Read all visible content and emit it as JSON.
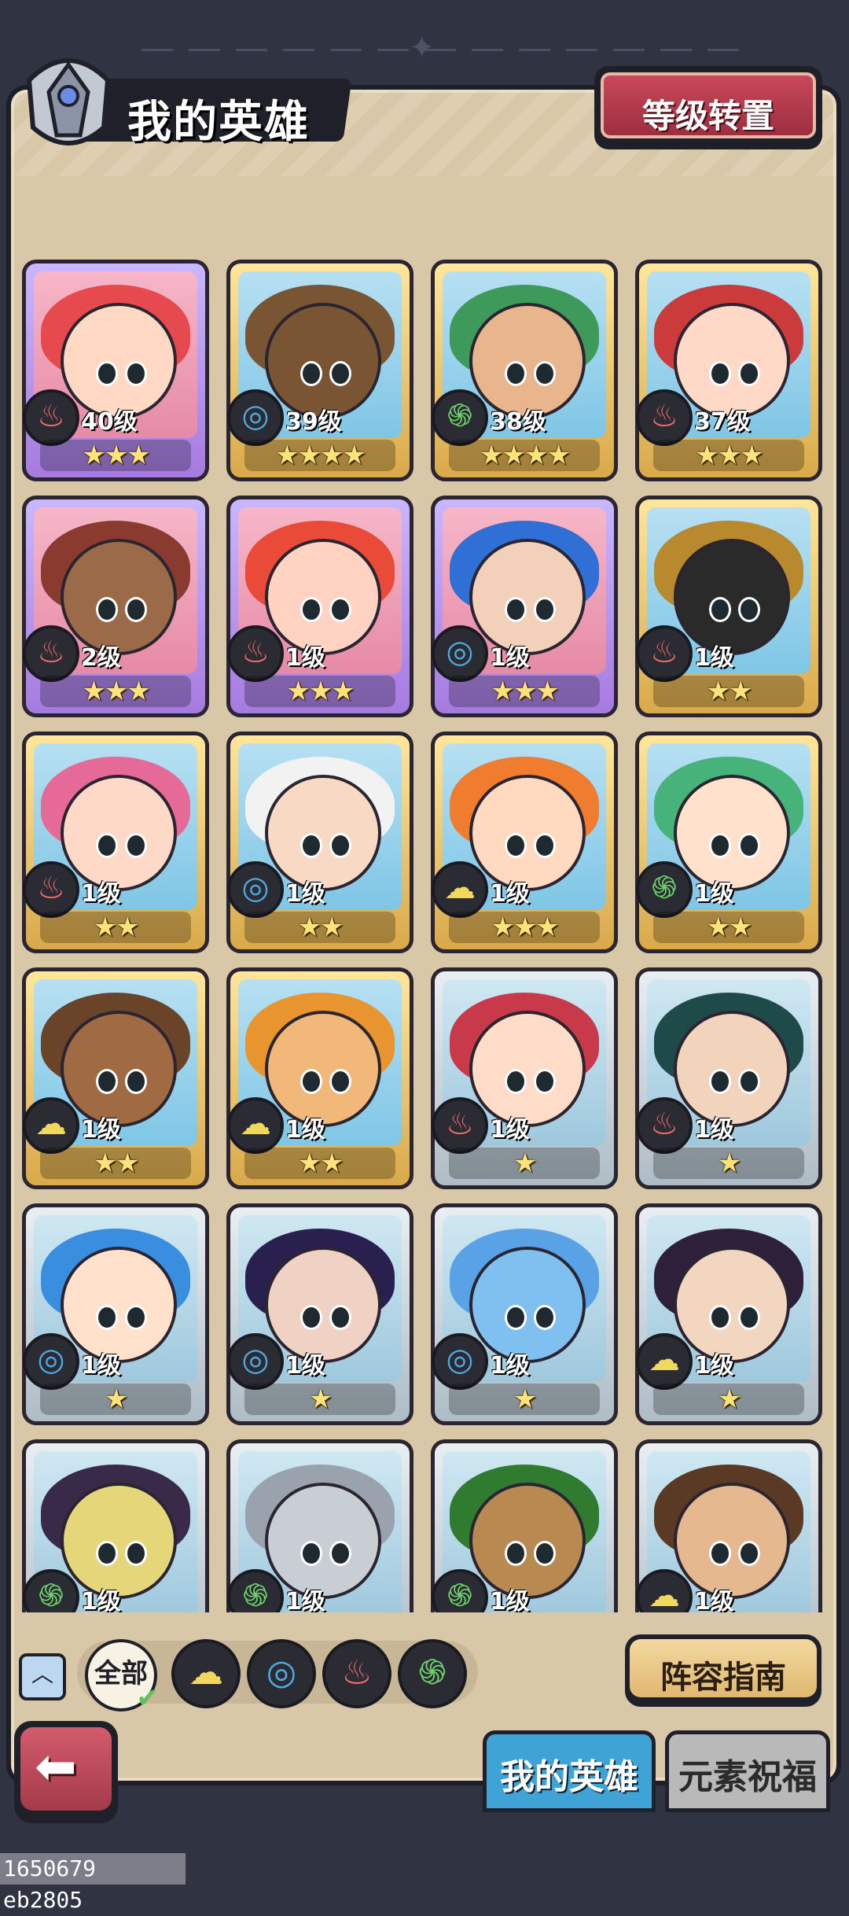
{
  "header": {
    "title": "我的英雄",
    "level_transfer_label": "等级转置"
  },
  "heroes": [
    {
      "level": "40级",
      "stars": "★★★",
      "element": "fire",
      "rarity": "purple",
      "hair": "#e64a4f",
      "skin": "#ffd9c4"
    },
    {
      "level": "39级",
      "stars": "★★★★",
      "element": "water",
      "rarity": "gold",
      "hair": "#7a5534",
      "skin": "#7a5534"
    },
    {
      "level": "38级",
      "stars": "★★★★",
      "element": "wood",
      "rarity": "gold",
      "hair": "#3d9a5b",
      "skin": "#e9b58d"
    },
    {
      "level": "37级",
      "stars": "★★★",
      "element": "fire",
      "rarity": "gold",
      "hair": "#cc3b3b",
      "skin": "#ffd9c8"
    },
    {
      "level": "2级",
      "stars": "★★★",
      "element": "fire",
      "rarity": "purple",
      "hair": "#8a3a2e",
      "skin": "#9b6a48"
    },
    {
      "level": "1级",
      "stars": "★★★",
      "element": "fire",
      "rarity": "purple",
      "hair": "#ea4b38",
      "skin": "#ffd2c2"
    },
    {
      "level": "1级",
      "stars": "★★★",
      "element": "water",
      "rarity": "purple",
      "hair": "#2f6fd6",
      "skin": "#f2d0b9"
    },
    {
      "level": "1级",
      "stars": "★★",
      "element": "fire",
      "rarity": "gold",
      "hair": "#b9892e",
      "skin": "#2a2a2a"
    },
    {
      "level": "1级",
      "stars": "★★",
      "element": "fire",
      "rarity": "gold",
      "hair": "#e66a98",
      "skin": "#ffd9c8"
    },
    {
      "level": "1级",
      "stars": "★★",
      "element": "water",
      "rarity": "gold",
      "hair": "#f2f2f2",
      "skin": "#f7d9c4"
    },
    {
      "level": "1级",
      "stars": "★★★",
      "element": "earth",
      "rarity": "gold",
      "hair": "#f07c2f",
      "skin": "#ffd9c0"
    },
    {
      "level": "1级",
      "stars": "★★",
      "element": "wood",
      "rarity": "gold",
      "hair": "#46b37a",
      "skin": "#ffe1cc"
    },
    {
      "level": "1级",
      "stars": "★★",
      "element": "earth",
      "rarity": "gold",
      "hair": "#6a4428",
      "skin": "#a06a42"
    },
    {
      "level": "1级",
      "stars": "★★",
      "element": "earth",
      "rarity": "gold",
      "hair": "#e9952f",
      "skin": "#f2b87a"
    },
    {
      "level": "1级",
      "stars": "★",
      "element": "fire",
      "rarity": "silver",
      "hair": "#c8394a",
      "skin": "#ffdcc8"
    },
    {
      "level": "1级",
      "stars": "★",
      "element": "fire",
      "rarity": "silver",
      "hair": "#1f4a4a",
      "skin": "#f2d4bd"
    },
    {
      "level": "1级",
      "stars": "★",
      "element": "water",
      "rarity": "silver",
      "hair": "#3a8ee0",
      "skin": "#ffe1cc"
    },
    {
      "level": "1级",
      "stars": "★",
      "element": "water",
      "rarity": "silver",
      "hair": "#2a2050",
      "skin": "#f0d2c4"
    },
    {
      "level": "1级",
      "stars": "★",
      "element": "water",
      "rarity": "silver",
      "hair": "#5aa2e6",
      "skin": "#7fc0f0"
    },
    {
      "level": "1级",
      "stars": "★",
      "element": "earth",
      "rarity": "silver",
      "hair": "#2e1f3a",
      "skin": "#f2d6c0"
    },
    {
      "level": "1级",
      "stars": "",
      "element": "wood",
      "rarity": "silver",
      "hair": "#3a2a4a",
      "skin": "#e6d67a"
    },
    {
      "level": "1级",
      "stars": "",
      "element": "wood",
      "rarity": "silver",
      "hair": "#9aa3ad",
      "skin": "#c9ced4"
    },
    {
      "level": "1级",
      "stars": "",
      "element": "wood",
      "rarity": "silver",
      "hair": "#2f7b2f",
      "skin": "#b88a52"
    },
    {
      "level": "1级",
      "stars": "",
      "element": "earth",
      "rarity": "silver",
      "hair": "#5a3a24",
      "skin": "#e6b890"
    }
  ],
  "element_icons": {
    "fire": "♨",
    "water": "◎",
    "wood": "֍",
    "earth": "☁"
  },
  "filters": {
    "all_label": "全部",
    "elements": [
      "earth",
      "water",
      "fire",
      "wood"
    ]
  },
  "guide_label": "阵容指南",
  "tabs": {
    "my_heroes": "我的英雄",
    "element_blessing": "元素祝福"
  },
  "debug_text": "1650679 eb2805"
}
